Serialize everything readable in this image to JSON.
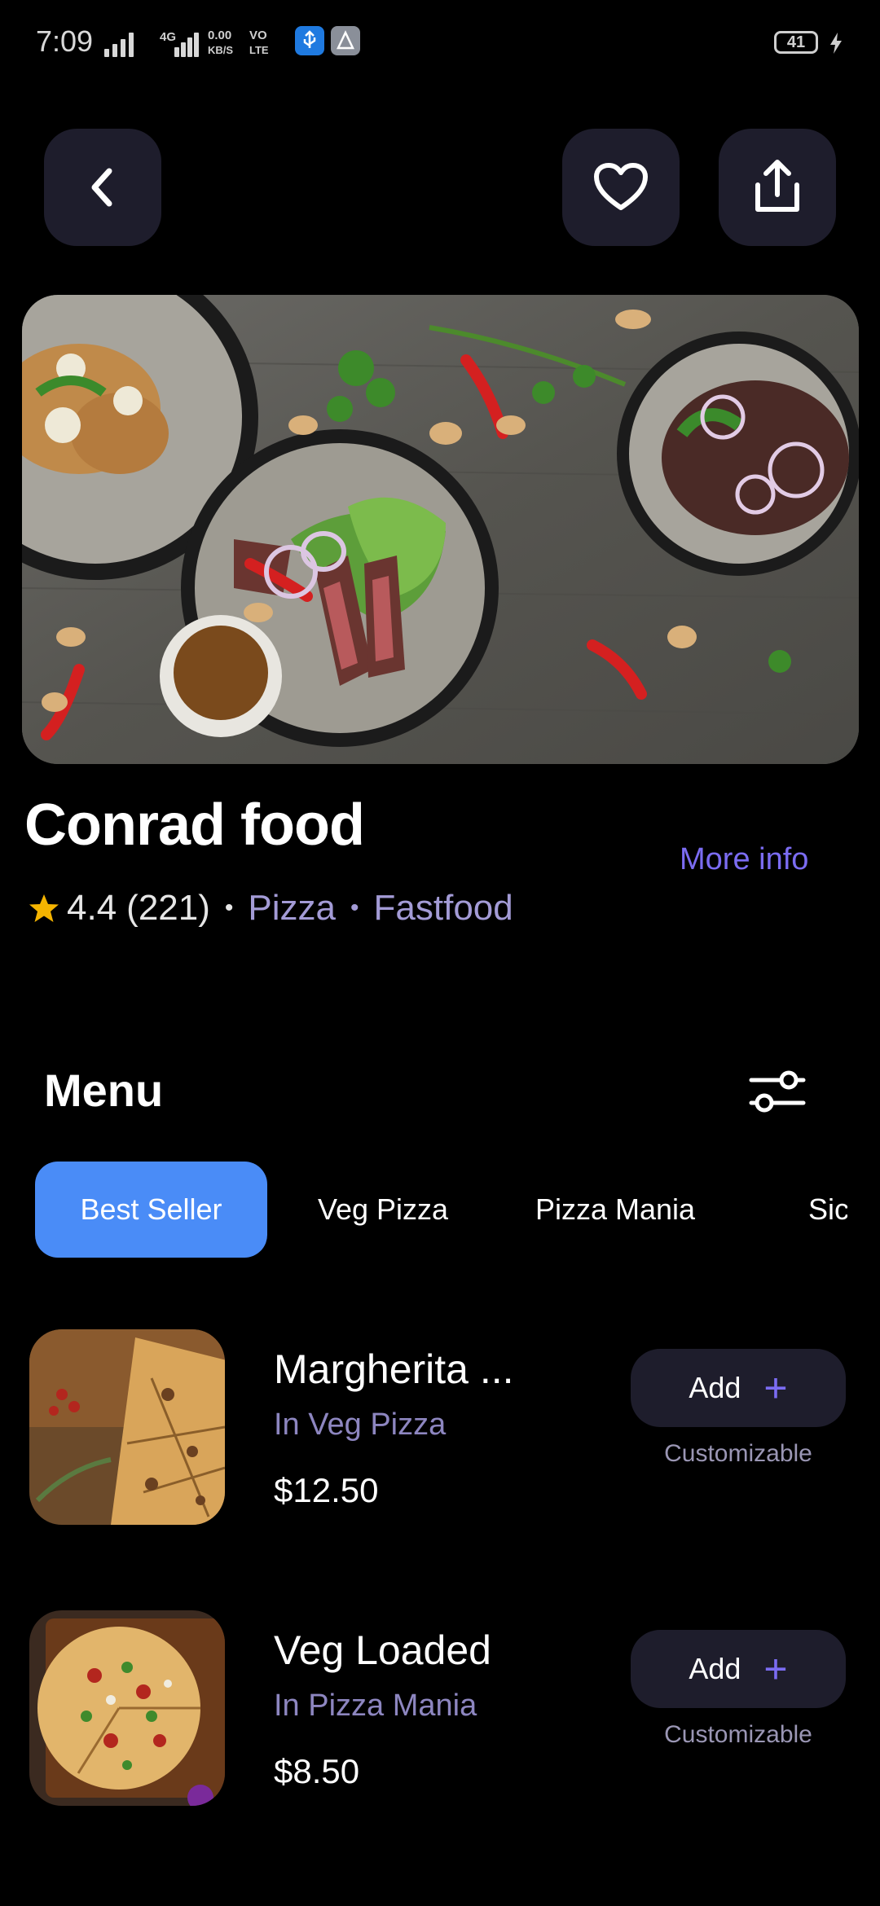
{
  "status": {
    "time": "7:09",
    "net_type": "4G",
    "speed_value": "0.00",
    "speed_unit": "KB/S",
    "volte_top": "VO",
    "volte_bottom": "LTE",
    "battery": "41"
  },
  "restaurant": {
    "name": "Conrad food",
    "more_info": "More info",
    "rating": "4.4",
    "reviews": "(221)",
    "categories": [
      "Pizza",
      "Fastfood"
    ]
  },
  "menu": {
    "title": "Menu",
    "tabs": [
      "Best Seller",
      "Veg Pizza",
      "Pizza Mania",
      "Sic"
    ],
    "active_tab": 0,
    "items": [
      {
        "name": "Margherita ...",
        "category": "In Veg Pizza",
        "price": "$12.50",
        "add_label": "Add",
        "note": "Customizable"
      },
      {
        "name": "Veg Loaded",
        "category": "In Pizza Mania",
        "price": "$8.50",
        "add_label": "Add",
        "note": "Customizable"
      }
    ]
  },
  "colors": {
    "accent": "#7b6cf2",
    "active_tab": "#4a8cf7",
    "button_bg": "#1e1d2c",
    "star": "#f5b400"
  },
  "icons": [
    "back-icon",
    "heart-icon",
    "share-icon",
    "star-icon",
    "filter-icon",
    "plus-icon"
  ]
}
